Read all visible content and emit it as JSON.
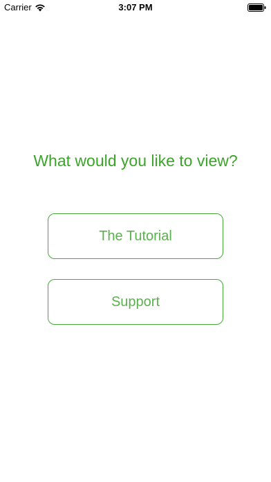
{
  "status_bar": {
    "carrier": "Carrier",
    "time": "3:07 PM"
  },
  "main": {
    "prompt": "What would you like to view?",
    "options": [
      {
        "label": "The Tutorial"
      },
      {
        "label": "Support"
      }
    ]
  },
  "colors": {
    "accent": "#3aa529",
    "border": "#46aa37",
    "background": "#ffffff"
  }
}
